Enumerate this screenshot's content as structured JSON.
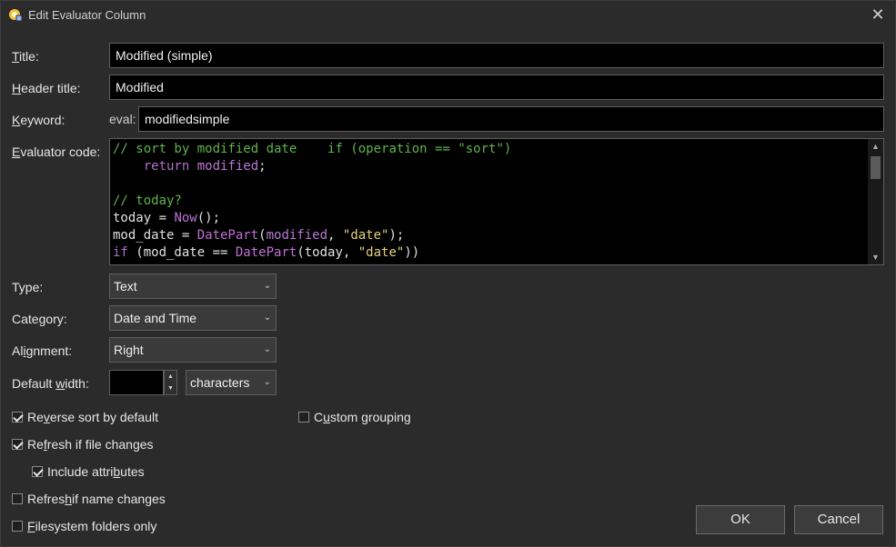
{
  "window": {
    "title": "Edit Evaluator Column",
    "close_glyph": "✕"
  },
  "labels": {
    "title_first": "T",
    "title_rest": "itle:",
    "header_first": "H",
    "header_rest": "eader title:",
    "keyword_first": "K",
    "keyword_rest": "eyword:",
    "code_first": "E",
    "code_rest": "valuator code:",
    "type": "Type:",
    "category": "Category:",
    "align_a": "Al",
    "align_u": "i",
    "align_b": "gnment:",
    "width_a": "Default ",
    "width_u": "w",
    "width_b": "idth:"
  },
  "fields": {
    "title": "Modified (simple)",
    "header_title": "Modified",
    "keyword_prefix": "eval:",
    "keyword": "modifiedsimple"
  },
  "code": {
    "l1_comment": "// sort by modified date",
    "l1_if": "if",
    "l1_open": " (operation == ",
    "l1_str": "\"sort\"",
    "l1_close": ")",
    "l2_return": "return",
    "l2_var": "modified",
    "l2_semi": ";",
    "l4_comment": "// today?",
    "l5_a": "today = ",
    "l5_fn": "Now",
    "l5_b": "();",
    "l6_a": "mod_date = ",
    "l6_fn": "DatePart",
    "l6_b": "(",
    "l6_var": "modified",
    "l6_c": ", ",
    "l6_str": "\"date\"",
    "l6_d": ");",
    "l7_if": "if",
    "l7_a": " (mod_date == ",
    "l7_fn": "DatePart",
    "l7_b": "(today, ",
    "l7_str": "\"date\"",
    "l7_c": "))"
  },
  "combos": {
    "type": "Text",
    "category": "Date and Time",
    "alignment": "Right",
    "width_unit": "characters"
  },
  "checkboxes": {
    "reverse_a": "Re",
    "reverse_u": "v",
    "reverse_b": "erse sort by default",
    "reverse_checked": true,
    "custom_a": "C",
    "custom_u": "u",
    "custom_b": "stom grouping",
    "custom_checked": false,
    "refresh_file_a": "Re",
    "refresh_file_u": "f",
    "refresh_file_b": "resh if file changes",
    "refresh_file_checked": true,
    "include_a": "Include attri",
    "include_u": "b",
    "include_b": "utes",
    "include_checked": true,
    "refresh_name_a": "Refres",
    "refresh_name_u": "h",
    "refresh_name_b": " if name changes",
    "refresh_name_checked": false,
    "fs_u": "F",
    "fs_b": "ilesystem folders only",
    "fs_checked": false
  },
  "buttons": {
    "ok": "OK",
    "cancel": "Cancel"
  },
  "icons": {
    "app": "evaluator-app-icon",
    "chevron": "chevron-down-icon",
    "close": "close-icon"
  }
}
